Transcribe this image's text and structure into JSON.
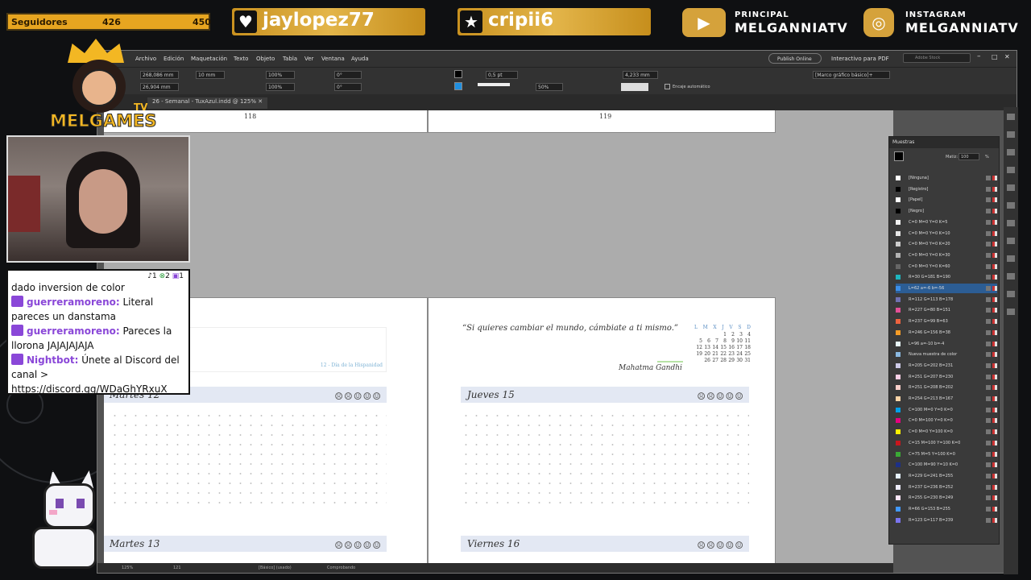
{
  "overlay": {
    "followers": {
      "label": "Seguidores",
      "current": "426",
      "goal": "450"
    },
    "banners": [
      {
        "icon": "heart-icon",
        "text": "jaylopez77"
      },
      {
        "icon": "star-icon",
        "text": "cripii6"
      }
    ],
    "socials": [
      {
        "icon": "youtube-icon",
        "title": "PRINCIPAL",
        "handle": "MELGANNIATV"
      },
      {
        "icon": "instagram-icon",
        "title": "INSTAGRAM",
        "handle": "MELGANNIATV"
      }
    ],
    "logo_text": "MELGAMES",
    "logo_tv": "TV"
  },
  "chat": {
    "badges": [
      "1",
      "2",
      "1"
    ],
    "lines": [
      {
        "user": "",
        "text": "dado inversion de color"
      },
      {
        "user": "guerreramoreno:",
        "text": "Literal pareces un danstama"
      },
      {
        "user": "guerreramoreno:",
        "text": "Pareces la llorona JAJAJAJAJA"
      },
      {
        "user": "Nightbot:",
        "text": "Únete al Discord del canal > https://discord.gg/WDaGhYRxuX"
      }
    ]
  },
  "indesign": {
    "menu": [
      "Archivo",
      "Edición",
      "Maquetación",
      "Texto",
      "Objeto",
      "Tabla",
      "Ver",
      "Ventana",
      "Ayuda"
    ],
    "publish": "Publish Online",
    "workspace": "Interactivo para PDF",
    "search_placeholder": "Adobe Stock",
    "fields": {
      "x": "268,086 mm",
      "y": "26,904 mm",
      "w": "10 mm",
      "scale1": "100%",
      "scale2": "100%",
      "angle1": "0°",
      "angle2": "0°",
      "stroke": "0,5 pt",
      "opacity": "50%",
      "dim": "4,233 mm",
      "frame_style": "[Marco gráfico básico]+",
      "autofit": "Encaje automático"
    },
    "doc_tab": "26 - Semanal - TuxAzul.indd @ 125%",
    "pages": {
      "left_num": "118",
      "right_num": "119"
    },
    "left_page": {
      "holiday": "12 - Día de la Hispanidad",
      "day1": "Martes 12",
      "day2": "Martes 13"
    },
    "right_page": {
      "quote": "“Si quieres cambiar el mundo, cámbiate a ti mismo.”",
      "author": "Mahatma Gandhi",
      "day1": "Jueves 15",
      "day2": "Viernes 16",
      "cal_head": [
        "L",
        "M",
        "X",
        "J",
        "V",
        "S",
        "D"
      ],
      "cal_rows": [
        [
          "",
          "",
          "",
          "",
          "",
          "1",
          "2",
          "3",
          "4"
        ],
        [
          "5",
          "6",
          "7",
          "8",
          "9",
          "10",
          "11"
        ],
        [
          "12",
          "13",
          "14",
          "15",
          "16",
          "17",
          "18"
        ],
        [
          "19",
          "20",
          "21",
          "22",
          "23",
          "24",
          "25"
        ],
        [
          "26",
          "27",
          "28",
          "29",
          "30",
          "31",
          ""
        ]
      ]
    },
    "faces": "☹☹☺☺☺",
    "status": {
      "zoom": "125%",
      "page": "121",
      "style": "[Básico] (usado)",
      "check": "Comprobando"
    }
  },
  "swatches": {
    "title": "Muestras",
    "tint_label": "Matiz:",
    "tint_value": "100",
    "tint_unit": "%",
    "items": [
      {
        "name": "[Ninguna]",
        "color": "#ffffff"
      },
      {
        "name": "[Registro]",
        "color": "#000000"
      },
      {
        "name": "[Papel]",
        "color": "#ffffff"
      },
      {
        "name": "[Negro]",
        "color": "#000000"
      },
      {
        "name": "C=0 M=0 Y=0 K=5",
        "color": "#f2f2f2"
      },
      {
        "name": "C=0 M=0 Y=0 K=10",
        "color": "#e6e6e6"
      },
      {
        "name": "C=0 M=0 Y=0 K=20",
        "color": "#cccccc"
      },
      {
        "name": "C=0 M=0 Y=0 K=30",
        "color": "#b3b3b3"
      },
      {
        "name": "C=0 M=0 Y=0 K=60",
        "color": "#666666"
      },
      {
        "name": "R=30 G=181 B=190",
        "color": "#1eb5be"
      },
      {
        "name": "L=62 a=-6 b=-56",
        "color": "#3b8ee8"
      },
      {
        "name": "R=112 G=113 B=178",
        "color": "#7071b2"
      },
      {
        "name": "R=227 G=80 B=151",
        "color": "#e35097"
      },
      {
        "name": "R=237 G=99 B=63",
        "color": "#ed633f"
      },
      {
        "name": "R=246 G=156 B=38",
        "color": "#f69c26"
      },
      {
        "name": "L=96 a=-10 b=-4",
        "color": "#e8f7f9"
      },
      {
        "name": "Nueva muestra de color",
        "color": "#8ab8e0"
      },
      {
        "name": "R=205 G=202 B=231",
        "color": "#cdcae7"
      },
      {
        "name": "R=251 G=207 B=230",
        "color": "#fbcfe6"
      },
      {
        "name": "R=251 G=208 B=202",
        "color": "#fbd0ca"
      },
      {
        "name": "R=254 G=213 B=167",
        "color": "#fed5a7"
      },
      {
        "name": "C=100 M=0 Y=0 K=0",
        "color": "#00a0e9"
      },
      {
        "name": "C=0 M=100 Y=0 K=0",
        "color": "#e4007f"
      },
      {
        "name": "C=0 M=0 Y=100 K=0",
        "color": "#fff100"
      },
      {
        "name": "C=15 M=100 Y=100 K=0",
        "color": "#c8161d"
      },
      {
        "name": "C=75 M=5 Y=100 K=0",
        "color": "#3aa935"
      },
      {
        "name": "C=100 M=90 Y=10 K=0",
        "color": "#1d3087"
      },
      {
        "name": "R=229 G=241 B=255",
        "color": "#e5f1ff"
      },
      {
        "name": "R=237 G=236 B=252",
        "color": "#edecfc"
      },
      {
        "name": "R=255 G=230 B=249",
        "color": "#ffe6f9"
      },
      {
        "name": "R=66 G=153 B=255",
        "color": "#4299ff"
      },
      {
        "name": "R=123 G=117 B=239",
        "color": "#7b75ef"
      }
    ]
  }
}
